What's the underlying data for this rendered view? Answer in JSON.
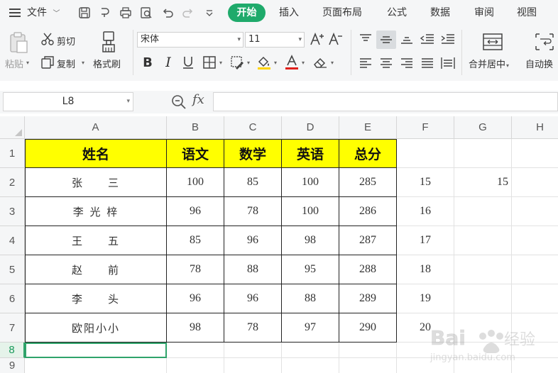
{
  "menubar": {
    "file_label": "文件",
    "tabs": [
      {
        "label": "开始"
      },
      {
        "label": "插入"
      },
      {
        "label": "页面布局"
      },
      {
        "label": "公式"
      },
      {
        "label": "数据"
      },
      {
        "label": "审阅"
      },
      {
        "label": "视图"
      }
    ]
  },
  "ribbon": {
    "paste_label": "粘贴",
    "cut_label": "剪切",
    "copy_label": "复制",
    "format_painter_label": "格式刷",
    "font_name": "宋体",
    "font_size": "11",
    "merge_label": "合并居中",
    "autowrap_label": "自动换"
  },
  "formula_bar": {
    "name_box": "L8",
    "fx_label": "fx",
    "formula": ""
  },
  "sheet": {
    "columns": [
      "A",
      "B",
      "C",
      "D",
      "E",
      "F",
      "G",
      "H"
    ],
    "rows": [
      "1",
      "2",
      "3",
      "4",
      "5",
      "6",
      "7",
      "8",
      "9"
    ],
    "headers": [
      "姓名",
      "语文",
      "数学",
      "英语",
      "总分"
    ],
    "records": [
      {
        "name": "张　　三",
        "c1": "100",
        "c2": "85",
        "c3": "100",
        "total": "285",
        "f": "15",
        "g": "15"
      },
      {
        "name": "李 光 梓",
        "c1": "96",
        "c2": "78",
        "c3": "100",
        "total": "286",
        "f": "16",
        "g": ""
      },
      {
        "name": "王　　五",
        "c1": "85",
        "c2": "96",
        "c3": "98",
        "total": "287",
        "f": "17",
        "g": ""
      },
      {
        "name": "赵　　前",
        "c1": "78",
        "c2": "88",
        "c3": "95",
        "total": "288",
        "f": "18",
        "g": ""
      },
      {
        "name": "李　　头",
        "c1": "96",
        "c2": "96",
        "c3": "88",
        "total": "289",
        "f": "19",
        "g": ""
      },
      {
        "name": "欧阳小小",
        "c1": "98",
        "c2": "78",
        "c3": "97",
        "total": "290",
        "f": "20",
        "g": ""
      }
    ]
  },
  "colors": {
    "accent": "#1faa6b",
    "header_fill": "#ffff00"
  },
  "watermark": {
    "brand": "Bai",
    "brand_cn": "经验",
    "domain": "jingyan.baidu.com"
  }
}
